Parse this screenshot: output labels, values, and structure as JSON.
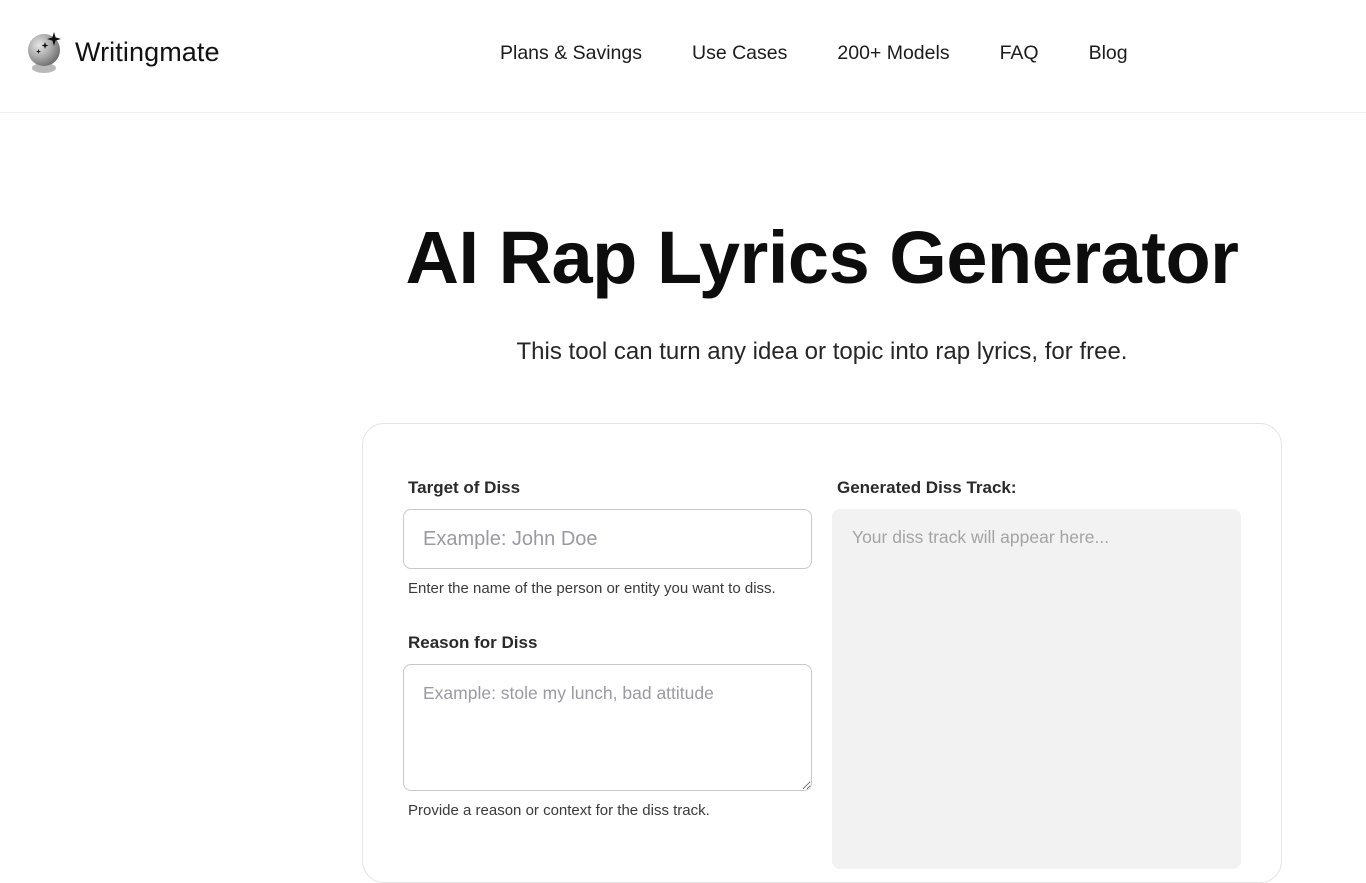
{
  "header": {
    "brand": "Writingmate",
    "logo_icon": "crystal-ball-sparkle-icon",
    "nav": [
      {
        "label": "Plans & Savings"
      },
      {
        "label": "Use Cases"
      },
      {
        "label": "200+ Models"
      },
      {
        "label": "FAQ"
      },
      {
        "label": "Blog"
      }
    ]
  },
  "hero": {
    "title": "AI Rap Lyrics Generator",
    "subtitle": "This tool can turn any idea or topic into rap lyrics, for free."
  },
  "form": {
    "target": {
      "label": "Target of Diss",
      "placeholder": "Example: John Doe",
      "value": "",
      "help": "Enter the name of the person or entity you want to diss."
    },
    "reason": {
      "label": "Reason for Diss",
      "placeholder": "Example: stole my lunch, bad attitude",
      "value": "",
      "help": "Provide a reason or context for the diss track."
    },
    "output": {
      "label": "Generated Diss Track:",
      "placeholder": "Your diss track will appear here..."
    }
  },
  "colors": {
    "text": "#111111",
    "border": "#e4e4e4",
    "input_border": "#c9c9c9",
    "output_bg": "#f2f2f2",
    "placeholder": "#9a9aa2"
  }
}
